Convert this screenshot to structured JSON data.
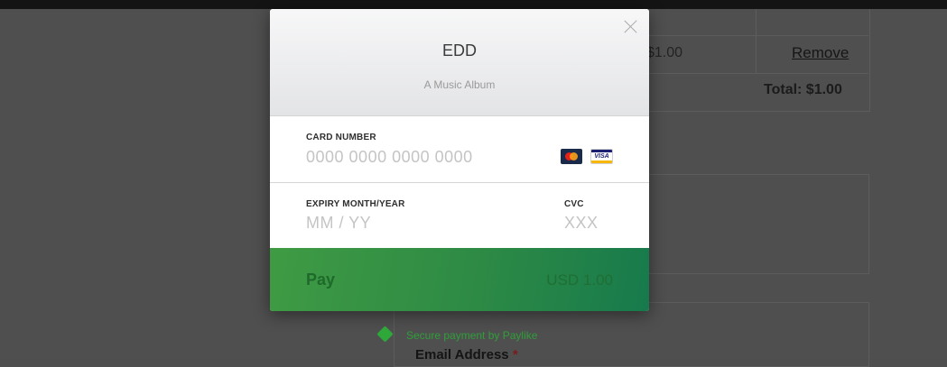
{
  "background": {
    "cart": {
      "price": "$1.00",
      "remove_label": "Remove",
      "total": "Total: $1.00"
    },
    "email_label": "Email Address",
    "required_mark": "*"
  },
  "modal": {
    "title": "EDD",
    "subtitle": "A Music Album",
    "card_number": {
      "label": "CARD NUMBER",
      "placeholder": "0000 0000 0000 0000"
    },
    "card_brands": [
      "mastercard-icon",
      "visa-icon"
    ],
    "visa_text": "VISA",
    "expiry": {
      "label": "EXPIRY MONTH/YEAR",
      "placeholder": "MM / YY"
    },
    "cvc": {
      "label": "CVC",
      "placeholder": "XXX"
    },
    "pay_button": {
      "label": "Pay",
      "amount": "USD 1.00"
    }
  },
  "secure_note": "Secure payment by Paylike",
  "colors": {
    "pay_green": "#2d8a45",
    "secure_green": "#2fa83a"
  }
}
